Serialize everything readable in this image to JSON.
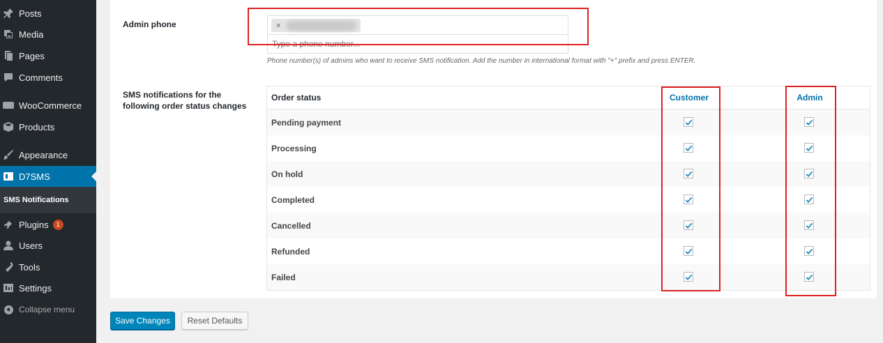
{
  "sidebar": {
    "items": [
      {
        "label": "Posts",
        "icon": "pin-icon"
      },
      {
        "label": "Media",
        "icon": "media-icon"
      },
      {
        "label": "Pages",
        "icon": "pages-icon"
      },
      {
        "label": "Comments",
        "icon": "comments-icon"
      },
      {
        "label": "WooCommerce",
        "icon": "woocommerce-icon"
      },
      {
        "label": "Products",
        "icon": "products-icon"
      },
      {
        "label": "Appearance",
        "icon": "appearance-icon"
      },
      {
        "label": "D7SMS",
        "icon": "d7sms-icon"
      },
      {
        "label": "Plugins",
        "icon": "plugins-icon",
        "badge": "1"
      },
      {
        "label": "Users",
        "icon": "users-icon"
      },
      {
        "label": "Tools",
        "icon": "tools-icon"
      },
      {
        "label": "Settings",
        "icon": "settings-icon"
      }
    ],
    "submenu_label": "SMS Notifications",
    "collapse_label": "Collapse menu"
  },
  "form": {
    "admin_phone_label": "Admin phone",
    "phone_placeholder": "Type a phone number...",
    "phone_description": "Phone number(s) of admins who want to receive SMS notification. Add the number in international format with \"+\" prefix and press ENTER.",
    "sms_label_line1": "SMS notifications for the",
    "sms_label_line2": "following order status changes"
  },
  "table": {
    "headers": {
      "status": "Order status",
      "customer": "Customer",
      "admin": "Admin"
    },
    "rows": [
      {
        "status": "Pending payment",
        "customer": true,
        "admin": true
      },
      {
        "status": "Processing",
        "customer": true,
        "admin": true
      },
      {
        "status": "On hold",
        "customer": true,
        "admin": true
      },
      {
        "status": "Completed",
        "customer": true,
        "admin": true
      },
      {
        "status": "Cancelled",
        "customer": true,
        "admin": true
      },
      {
        "status": "Refunded",
        "customer": true,
        "admin": true
      },
      {
        "status": "Failed",
        "customer": true,
        "admin": true
      }
    ]
  },
  "buttons": {
    "save": "Save Changes",
    "reset": "Reset Defaults"
  },
  "colors": {
    "accent": "#0073aa",
    "sidebar": "#23282d",
    "highlight": "#dd1f1f",
    "badge": "#ca4a1f"
  }
}
